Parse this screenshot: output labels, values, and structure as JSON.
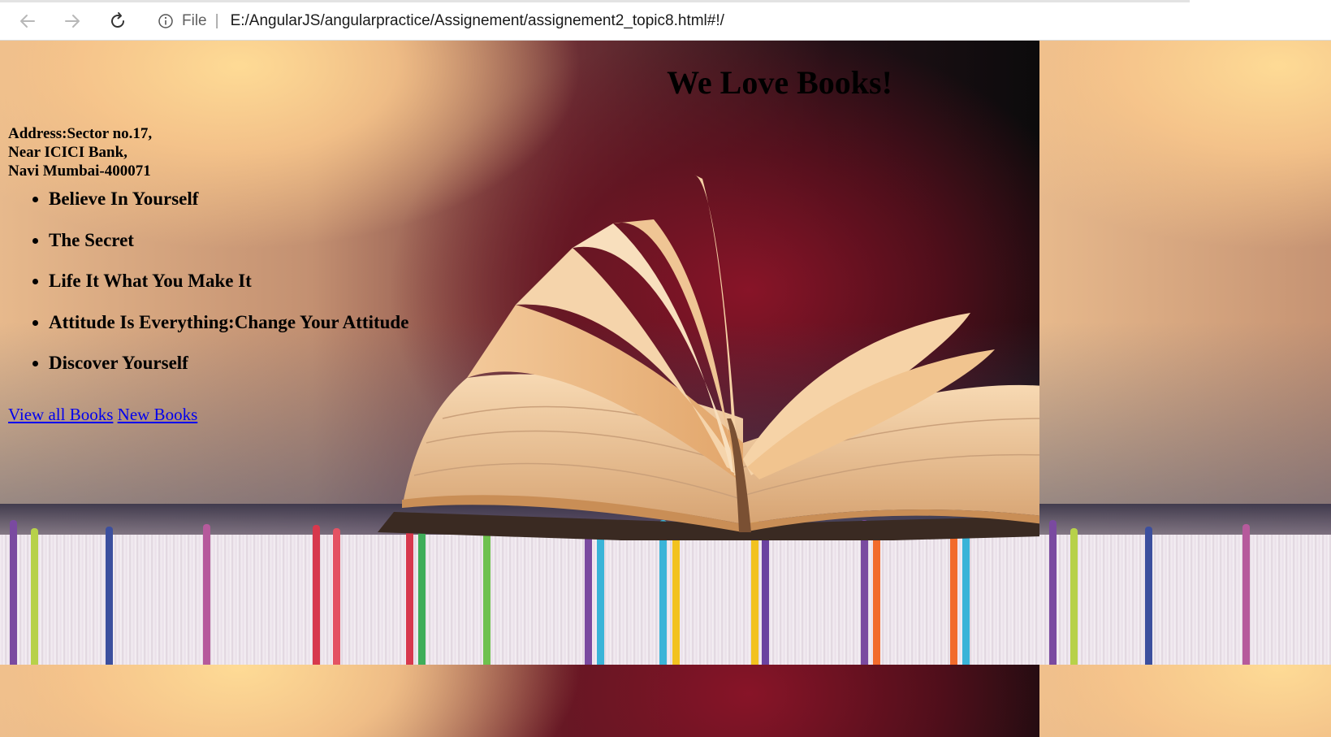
{
  "browser": {
    "back_icon": "back-arrow-icon",
    "forward_icon": "forward-arrow-icon",
    "reload_icon": "reload-icon",
    "info_icon": "info-icon",
    "scheme_label": "File",
    "separator": "|",
    "url": "E:/AngularJS/angularpractice/Assignement/assignement2_topic8.html#!/"
  },
  "page": {
    "title": "We Love Books!",
    "address_lines": [
      "Address:Sector no.17,",
      "Near ICICI Bank,",
      "Navi Mumbai-400071"
    ],
    "books": [
      "Believe In Yourself",
      "The Secret",
      "Life It What You Make It",
      "Attitude Is Everything:Change Your Attitude",
      "Discover Yourself"
    ],
    "links": {
      "view_all": "View all Books",
      "new_books": "New Books"
    },
    "background_image": "open-book-on-stack-of-books-photo"
  },
  "colors": {
    "link": "#0000ee",
    "text": "#000000"
  }
}
